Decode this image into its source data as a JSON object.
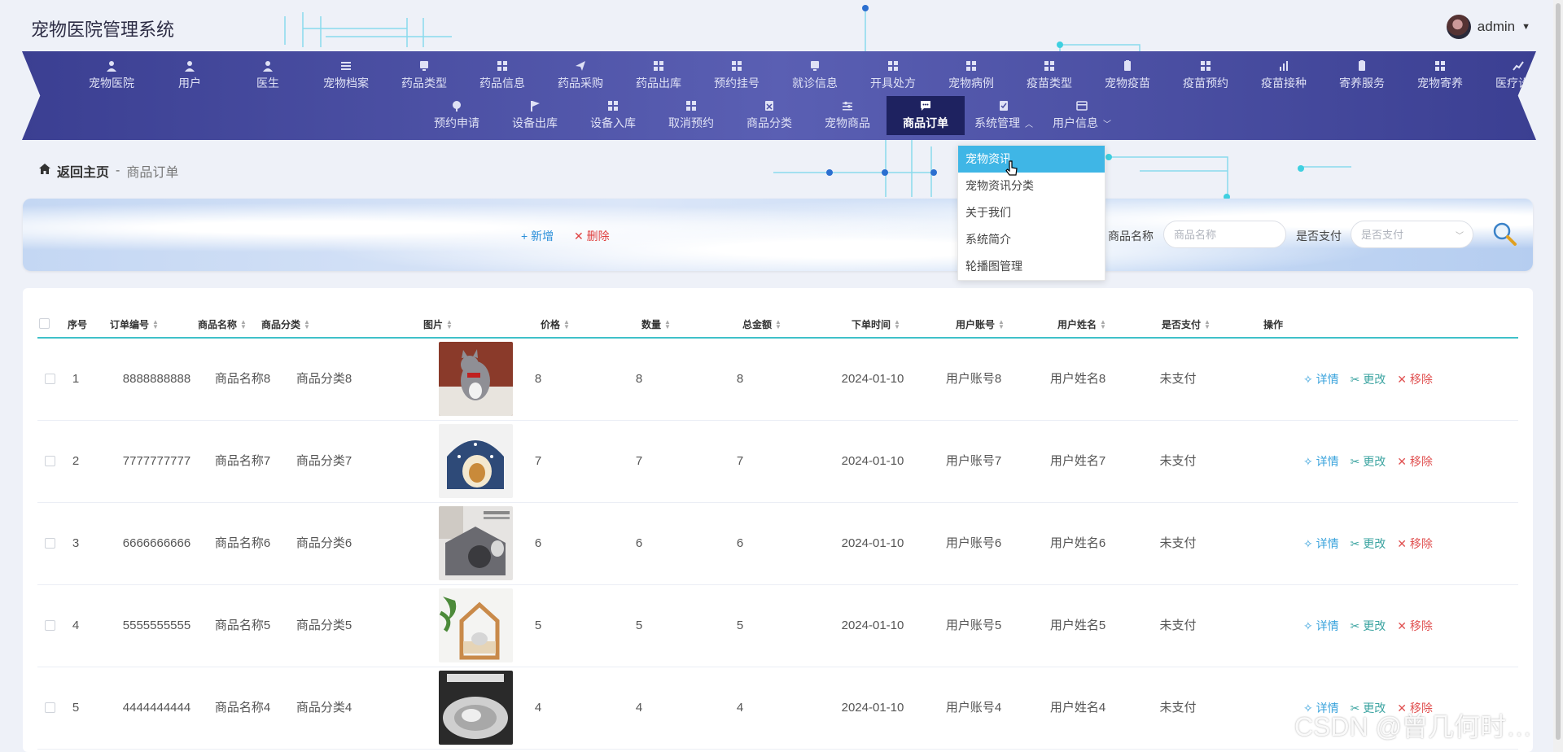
{
  "app": {
    "title": "宠物医院管理系统",
    "user": "admin"
  },
  "nav": {
    "row1": [
      "宠物医院",
      "用户",
      "医生",
      "宠物档案",
      "药品类型",
      "药品信息",
      "药品采购",
      "药品出库",
      "预约挂号",
      "就诊信息",
      "开具处方",
      "宠物病例",
      "疫苗类型",
      "宠物疫苗",
      "疫苗预约",
      "疫苗接种",
      "寄养服务",
      "宠物寄养",
      "医疗设备"
    ],
    "row2": [
      "预约申请",
      "设备出库",
      "设备入库",
      "取消预约",
      "商品分类",
      "宠物商品",
      "商品订单",
      "系统管理",
      "用户信息"
    ],
    "active": "商品订单"
  },
  "breadcrumb": {
    "home": "返回主页",
    "sep": "-",
    "current": "商品订单"
  },
  "toolbar": {
    "add_label": "+ 新增",
    "delete_label": "✕ 删除",
    "search_name_label": "商品名称",
    "search_name_placeholder": "商品名称",
    "search_paid_label": "是否支付",
    "search_paid_placeholder": "是否支付"
  },
  "dropdown": [
    "宠物资讯",
    "宠物资讯分类",
    "关于我们",
    "系统简介",
    "轮播图管理"
  ],
  "table": {
    "headers": [
      "序号",
      "订单编号",
      "商品名称",
      "商品分类",
      "图片",
      "价格",
      "数量",
      "总金额",
      "下单时间",
      "用户账号",
      "用户姓名",
      "是否支付",
      "操作"
    ],
    "rows": [
      {
        "idx": "1",
        "code": "8888888888",
        "name": "商品名称8",
        "cat": "商品分类8",
        "price": "8",
        "qty": "8",
        "total": "8",
        "time": "2024-01-10",
        "account": "用户账号8",
        "uname": "用户姓名8",
        "paid": "未支付"
      },
      {
        "idx": "2",
        "code": "7777777777",
        "name": "商品名称7",
        "cat": "商品分类7",
        "price": "7",
        "qty": "7",
        "total": "7",
        "time": "2024-01-10",
        "account": "用户账号7",
        "uname": "用户姓名7",
        "paid": "未支付"
      },
      {
        "idx": "3",
        "code": "6666666666",
        "name": "商品名称6",
        "cat": "商品分类6",
        "price": "6",
        "qty": "6",
        "total": "6",
        "time": "2024-01-10",
        "account": "用户账号6",
        "uname": "用户姓名6",
        "paid": "未支付"
      },
      {
        "idx": "4",
        "code": "5555555555",
        "name": "商品名称5",
        "cat": "商品分类5",
        "price": "5",
        "qty": "5",
        "total": "5",
        "time": "2024-01-10",
        "account": "用户账号5",
        "uname": "用户姓名5",
        "paid": "未支付"
      },
      {
        "idx": "5",
        "code": "4444444444",
        "name": "商品名称4",
        "cat": "商品分类4",
        "price": "4",
        "qty": "4",
        "total": "4",
        "time": "2024-01-10",
        "account": "用户账号4",
        "uname": "用户姓名4",
        "paid": "未支付"
      }
    ],
    "ops": {
      "detail": "详情",
      "edit": "更改",
      "delete": "移除"
    }
  },
  "watermark": "CSDN @曾几何时…",
  "colors": {
    "nav": "#4a4fa3",
    "accent": "#3fb6e6",
    "danger": "#e04040",
    "table_line": "#3fc1c9"
  }
}
